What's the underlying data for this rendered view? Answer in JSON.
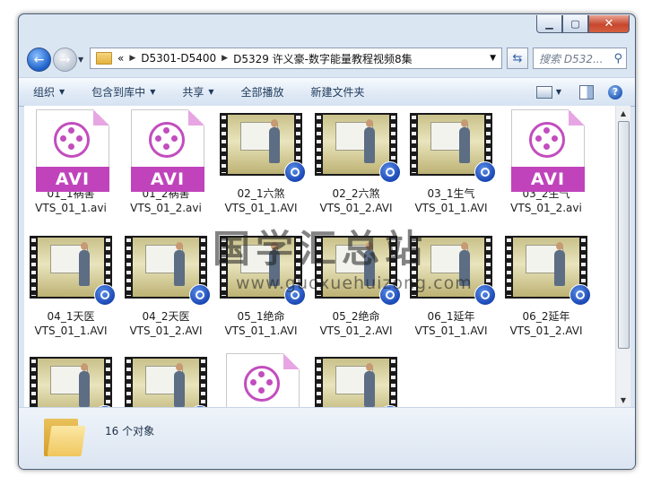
{
  "window": {
    "caption": {
      "minimize": "▁",
      "maximize": "▢",
      "close": "✕"
    }
  },
  "nav": {
    "back_icon": "←",
    "forward_icon": "→",
    "breadcrumbs": [
      "«",
      "D5301-D5400",
      "D5329 许义豪-数字能量教程视频8集"
    ],
    "search_placeholder": "搜索 D532..."
  },
  "toolbar": {
    "organize": "组织",
    "include_in_library": "包含到库中",
    "share": "共享",
    "play_all": "全部播放",
    "new_folder": "新建文件夹"
  },
  "files": [
    {
      "type": "avi",
      "line1": "01_1祸害",
      "line2": "VTS_01_1.avi"
    },
    {
      "type": "avi",
      "line1": "01_2祸害",
      "line2": "VTS_01_2.avi"
    },
    {
      "type": "video",
      "line1": "02_1六煞",
      "line2": "VTS_01_1.AVI"
    },
    {
      "type": "video",
      "line1": "02_2六煞",
      "line2": "VTS_01_2.AVI"
    },
    {
      "type": "video",
      "line1": "03_1生气",
      "line2": "VTS_01_1.AVI"
    },
    {
      "type": "avi",
      "line1": "03_2生气",
      "line2": "VTS_01_2.avi"
    },
    {
      "type": "video",
      "line1": "04_1天医",
      "line2": "VTS_01_1.AVI"
    },
    {
      "type": "video",
      "line1": "04_2天医",
      "line2": "VTS_01_2.AVI"
    },
    {
      "type": "video",
      "line1": "05_1绝命",
      "line2": "VTS_01_1.AVI"
    },
    {
      "type": "video",
      "line1": "05_2绝命",
      "line2": "VTS_01_2.AVI"
    },
    {
      "type": "video",
      "line1": "06_1延年",
      "line2": "VTS_01_1.AVI"
    },
    {
      "type": "video",
      "line1": "06_2延年",
      "line2": "VTS_01_2.AVI"
    },
    {
      "type": "video",
      "line1": "",
      "line2": ""
    },
    {
      "type": "video",
      "line1": "",
      "line2": ""
    },
    {
      "type": "avi",
      "line1": "",
      "line2": ""
    },
    {
      "type": "video",
      "line1": "",
      "line2": ""
    }
  ],
  "avi_badge": "AVI",
  "watermark": {
    "cn": "国学汇总站",
    "url": "www.guoxuehuizong.com"
  },
  "status": {
    "count": "16 个对象"
  }
}
